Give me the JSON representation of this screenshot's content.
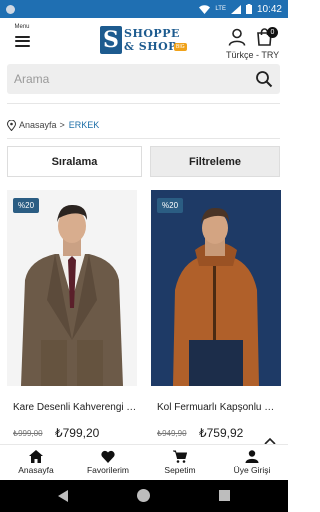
{
  "status_bar": {
    "time": "10:42",
    "network": "LTE",
    "icons": [
      "circle-icon",
      "wifi-icon",
      "lte-icon",
      "signal-icon",
      "battery-icon"
    ]
  },
  "header": {
    "menu_label": "Menu",
    "logo_line1": "SHOPPE",
    "logo_line2": "& SHOP",
    "logo_mark": "S",
    "logo_tag": "BIG",
    "locale": "Türkçe - TRY",
    "cart_count": "0"
  },
  "search": {
    "placeholder": "Arama"
  },
  "breadcrumb": {
    "home": "Anasayfa",
    "separator": ">",
    "current": "ERKEK"
  },
  "actions": {
    "sort_label": "Sıralama",
    "filter_label": "Filtreleme"
  },
  "products": [
    {
      "badge": "%20",
      "name": "Kare Desenli Kahverengi Takım Elbise",
      "old_price": "₺999,00",
      "new_price": "₺799,20"
    },
    {
      "badge": "%20",
      "name": "Kol Fermuarlı Kapşonlu Mont",
      "old_price": "₺949,90",
      "new_price": "₺759,92"
    }
  ],
  "bottom_nav": [
    {
      "label": "Anasayfa",
      "icon": "home-icon"
    },
    {
      "label": "Favorilerim",
      "icon": "heart-icon"
    },
    {
      "label": "Sepetim",
      "icon": "cart-icon"
    },
    {
      "label": "Üye Girişi",
      "icon": "user-icon"
    }
  ],
  "colors": {
    "status_bar": "#1f6fb2",
    "brand": "#1d5b8f",
    "badge": "#2b5d83",
    "breadcrumb_current": "#1d6fa8"
  }
}
